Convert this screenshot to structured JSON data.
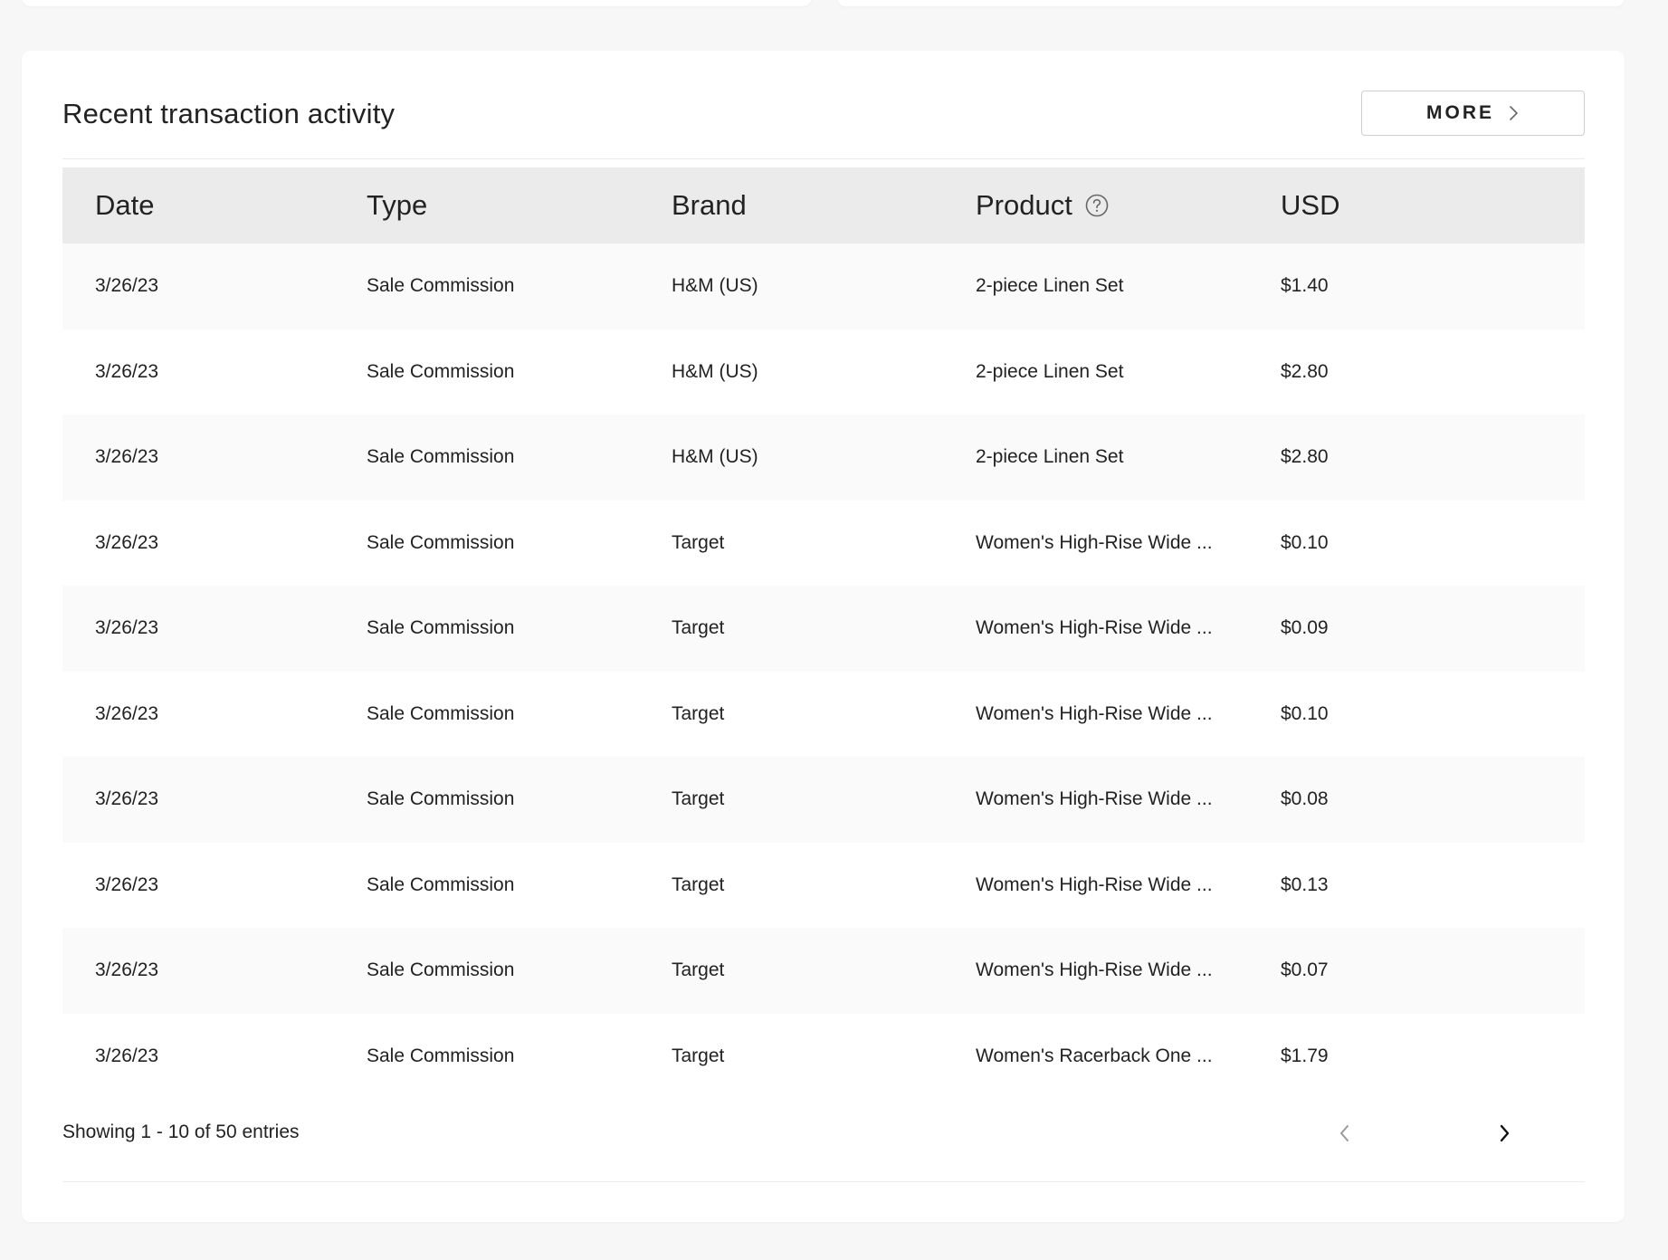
{
  "header": {
    "title": "Recent transaction activity",
    "more_label": "MORE"
  },
  "table": {
    "columns": [
      "Date",
      "Type",
      "Brand",
      "Product",
      "USD"
    ],
    "rows": [
      {
        "date": "3/26/23",
        "type": "Sale Commission",
        "brand": "H&M (US)",
        "product": "2-piece Linen Set",
        "usd": "$1.40"
      },
      {
        "date": "3/26/23",
        "type": "Sale Commission",
        "brand": "H&M (US)",
        "product": "2-piece Linen Set",
        "usd": "$2.80"
      },
      {
        "date": "3/26/23",
        "type": "Sale Commission",
        "brand": "H&M (US)",
        "product": "2-piece Linen Set",
        "usd": "$2.80"
      },
      {
        "date": "3/26/23",
        "type": "Sale Commission",
        "brand": "Target",
        "product": "Women's High-Rise Wide ...",
        "usd": "$0.10"
      },
      {
        "date": "3/26/23",
        "type": "Sale Commission",
        "brand": "Target",
        "product": "Women's High-Rise Wide ...",
        "usd": "$0.09"
      },
      {
        "date": "3/26/23",
        "type": "Sale Commission",
        "brand": "Target",
        "product": "Women's High-Rise Wide ...",
        "usd": "$0.10"
      },
      {
        "date": "3/26/23",
        "type": "Sale Commission",
        "brand": "Target",
        "product": "Women's High-Rise Wide ...",
        "usd": "$0.08"
      },
      {
        "date": "3/26/23",
        "type": "Sale Commission",
        "brand": "Target",
        "product": "Women's High-Rise Wide ...",
        "usd": "$0.13"
      },
      {
        "date": "3/26/23",
        "type": "Sale Commission",
        "brand": "Target",
        "product": "Women's High-Rise Wide ...",
        "usd": "$0.07"
      },
      {
        "date": "3/26/23",
        "type": "Sale Commission",
        "brand": "Target",
        "product": "Women's Racerback One ...",
        "usd": "$1.79"
      }
    ]
  },
  "footer": {
    "showing": "Showing 1 - 10 of 50 entries"
  },
  "icons": {
    "more": "chevron-right-icon",
    "product_help": "question-circle-icon",
    "prev": "chevron-left-icon",
    "next": "chevron-right-icon"
  },
  "colors": {
    "card_background": "#ffffff",
    "page_background": "#f7f7f7",
    "header_row": "#ebebeb",
    "striped_row": "#fafafa",
    "text": "#222222",
    "disabled": "#9a9a9a"
  }
}
